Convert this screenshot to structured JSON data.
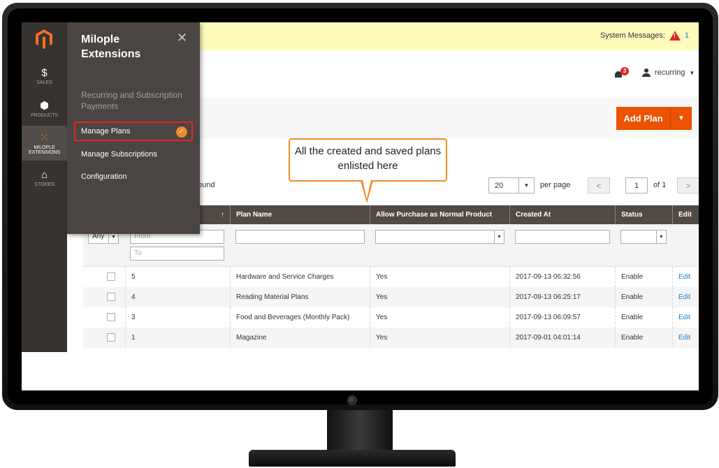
{
  "system_messages": {
    "label": "System Messages:",
    "count": "1"
  },
  "notifications": {
    "badge": "3"
  },
  "user": {
    "name": "recurring"
  },
  "action": {
    "add_plan_label": "Add Plan"
  },
  "sidebar": {
    "items": [
      {
        "label": "SALES",
        "icon": "dollar-icon",
        "glyph": "$"
      },
      {
        "label": "PRODUCTS",
        "icon": "box-icon",
        "glyph": "⬢"
      },
      {
        "label": "MILOPLE EXTENSIONS",
        "icon": "grid-icon",
        "glyph": "⁙"
      },
      {
        "label": "STORES",
        "icon": "store-icon",
        "glyph": "⌂"
      }
    ]
  },
  "flyout": {
    "title": "Milople Extensions",
    "section": "Recurring and Subscription Payments",
    "items": [
      "Manage Plans",
      "Manage Subscriptions",
      "Configuration"
    ]
  },
  "callout": {
    "text": "All the created and saved plans enlisted here"
  },
  "grid": {
    "records_found_fragment": "ound",
    "per_page_value": "20",
    "per_page_label": "per page",
    "page_value": "1",
    "page_total": "of 1",
    "columns": [
      "",
      "Plan Name",
      "Allow Purchase as Normal Product",
      "Created At",
      "Status",
      "Edit"
    ],
    "filters": {
      "any": "Any",
      "from": "From",
      "to": "To"
    },
    "rows": [
      {
        "id": "5",
        "name": "Hardware and Service Charges",
        "allow": "Yes",
        "created": "2017-09-13 06:32:56",
        "status": "Enable",
        "edit": "Edit"
      },
      {
        "id": "4",
        "name": "Reading Material Plans",
        "allow": "Yes",
        "created": "2017-09-13 06:25:17",
        "status": "Enable",
        "edit": "Edit"
      },
      {
        "id": "3",
        "name": "Food and Beverages (Monthly Pack)",
        "allow": "Yes",
        "created": "2017-09-13 06:09:57",
        "status": "Enable",
        "edit": "Edit"
      },
      {
        "id": "1",
        "name": "Magazine",
        "allow": "Yes",
        "created": "2017-09-01 04:01:14",
        "status": "Enable",
        "edit": "Edit"
      }
    ]
  },
  "colors": {
    "accent": "#eb5202",
    "sidebar": "#373330",
    "header": "#514943",
    "link": "#1979c3",
    "callout_border": "#f08a24"
  }
}
